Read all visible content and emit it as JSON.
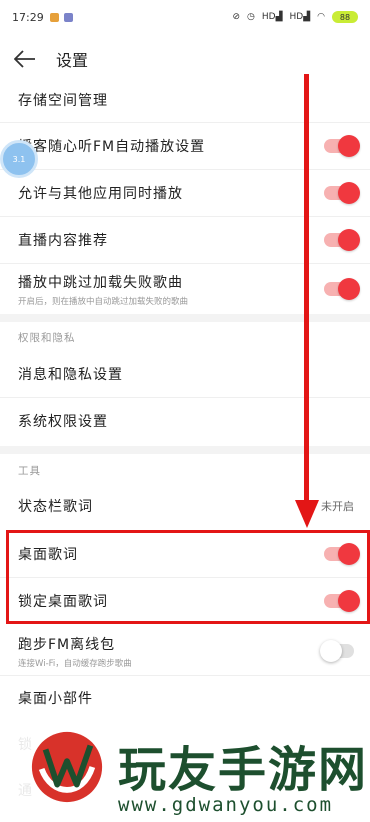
{
  "statusbar": {
    "time": "17:29",
    "network1": "HD",
    "network2": "HD",
    "battery": "88"
  },
  "header": {
    "title": "设置"
  },
  "settings": [
    {
      "label": "存储空间管理"
    },
    {
      "label": "播客随心听FM自动播放设置",
      "toggle": "on"
    },
    {
      "label": "允许与其他应用同时播放",
      "toggle": "on"
    },
    {
      "label": "直播内容推荐",
      "toggle": "on"
    },
    {
      "label": "播放中跳过加载失败歌曲",
      "sub": "开启后，则在播放中自动跳过加载失败的歌曲",
      "toggle": "on"
    }
  ],
  "privacy": {
    "title": "权限和隐私",
    "items": [
      {
        "label": "消息和隐私设置"
      },
      {
        "label": "系统权限设置"
      }
    ]
  },
  "tools": {
    "title": "工具",
    "items": [
      {
        "label": "状态栏歌词",
        "value": "未开启"
      },
      {
        "label": "桌面歌词",
        "toggle": "on"
      },
      {
        "label": "锁定桌面歌词",
        "toggle": "on"
      },
      {
        "label": "跑步FM离线包",
        "sub": "连接Wi-Fi，自动缓存跑步歌曲",
        "toggle": "off"
      },
      {
        "label": "桌面小部件"
      },
      {
        "label": "锁"
      },
      {
        "label": "通"
      }
    ]
  },
  "float_ball": {
    "text": "3.1"
  },
  "watermark": {
    "title": "玩友手游网",
    "url": "www.gdwanyou.com"
  },
  "colors": {
    "accent": "#f0383f",
    "annotation": "#e31616",
    "watermark": "#1d4f2e"
  }
}
